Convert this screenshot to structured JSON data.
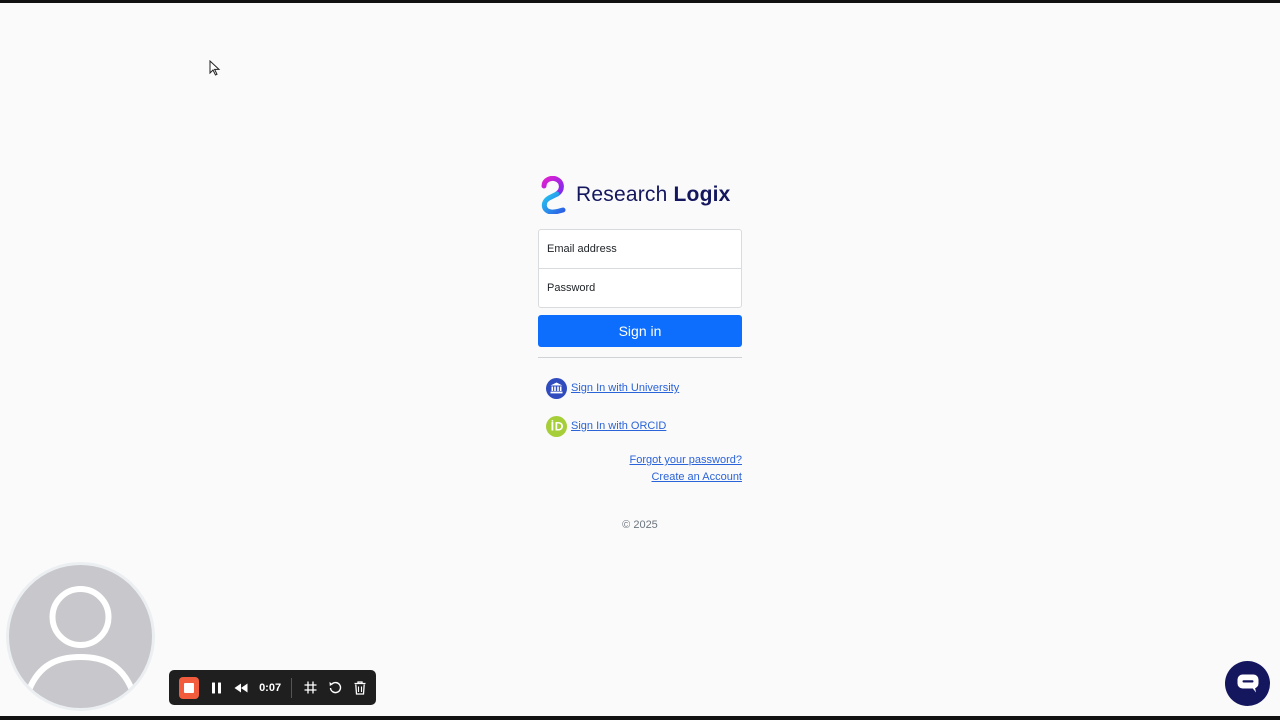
{
  "brand": {
    "name_light": "Research",
    "name_bold": "Logix"
  },
  "form": {
    "email_placeholder": "Email address",
    "password_placeholder": "Password",
    "signin_label": "Sign in"
  },
  "alt_logins": {
    "university_label": " Sign In with University",
    "orcid_label": " Sign In with ORCID"
  },
  "links": {
    "forgot_password": "Forgot your password?",
    "create_account": "Create an Account"
  },
  "footer": {
    "copyright": "© 2025"
  },
  "recorder": {
    "elapsed": "0:07"
  },
  "colors": {
    "primary": "#0d6efd",
    "brand_navy": "#14175e",
    "link": "#2b63d9",
    "orcid_green": "#a6ce39",
    "university_blue": "#2f4bbd",
    "record_red": "#f25c3c"
  }
}
